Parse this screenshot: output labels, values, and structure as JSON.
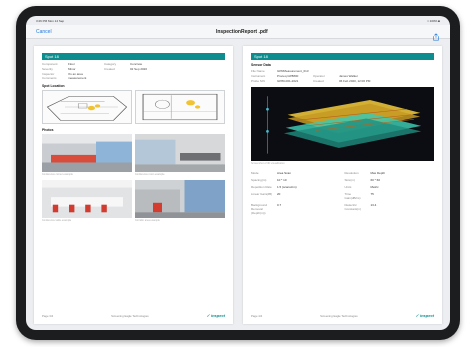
{
  "status": {
    "time": "3:26 PM  Mon 14 Sep",
    "battery": "≈ 100% ■"
  },
  "nav": {
    "cancel": "Cancel",
    "title": "InspectionReport .pdf"
  },
  "left": {
    "spot": "Spot 18",
    "fields": [
      {
        "label": "Component",
        "value": "Floor",
        "label2": "Category",
        "value2": "Concrete"
      },
      {
        "label": "Severity",
        "value": "Minor",
        "label2": "Created",
        "value2": "02 Sep 2020"
      },
      {
        "label": "Inspector Comments",
        "value": "It's an area measurement",
        "label2": "",
        "value2": ""
      }
    ],
    "spot_location": "Spot Location",
    "photos_title": "Photos",
    "photo_captions": [
      "Conference corner example",
      "Conference room example",
      "Conference table example",
      "Corridor area example"
    ],
    "footer_page": "Page 3/4",
    "footer_company": "Screening Eagle Technologies",
    "brand": "✓ inspect"
  },
  "right": {
    "spot": "Spot 18",
    "sensor_title": "Sensor Data",
    "fields": [
      {
        "label": "File Name",
        "value": "GPRMeasurement_013",
        "label2": "",
        "value2": ""
      },
      {
        "label": "Instrument",
        "value": "Proceq GP8800",
        "label2": "Operator",
        "value2": "James Walker"
      },
      {
        "label": "Probe S/N",
        "value": "GP80-001-2021",
        "label2": "Created",
        "value2": "06 Feb 2020, 12:06 PM"
      }
    ],
    "viz_caption": "Screenshot of 3D visualization",
    "params": [
      {
        "label": "Mode",
        "value": "Area Scan",
        "label2": "Resolution",
        "value2": "Max Depth"
      },
      {
        "label": "Spacing(m)",
        "value": "10 * 10",
        "label2": "Size(m)",
        "value2": "60 * 60"
      },
      {
        "label": "Repetition Rate",
        "value": "1.5 (scans/cm)",
        "label2": "Units",
        "value2": "Metric"
      },
      {
        "label": "Linear Gain(dB)",
        "value": "20",
        "label2": "Time Gain(dB/ns)",
        "value2": "75"
      },
      {
        "label": "Background Removal (Depth(m))",
        "value": "0.7",
        "label2": "Dielectric Constant(m)",
        "value2": "13.4"
      }
    ],
    "footer_page": "Page 4/4",
    "footer_company": "Screening Eagle Technologies",
    "brand": "✓ inspect"
  },
  "colors": {
    "accent": "#0e8d8f",
    "link": "#1f7ae0"
  },
  "icons": {
    "share": "share-icon"
  }
}
